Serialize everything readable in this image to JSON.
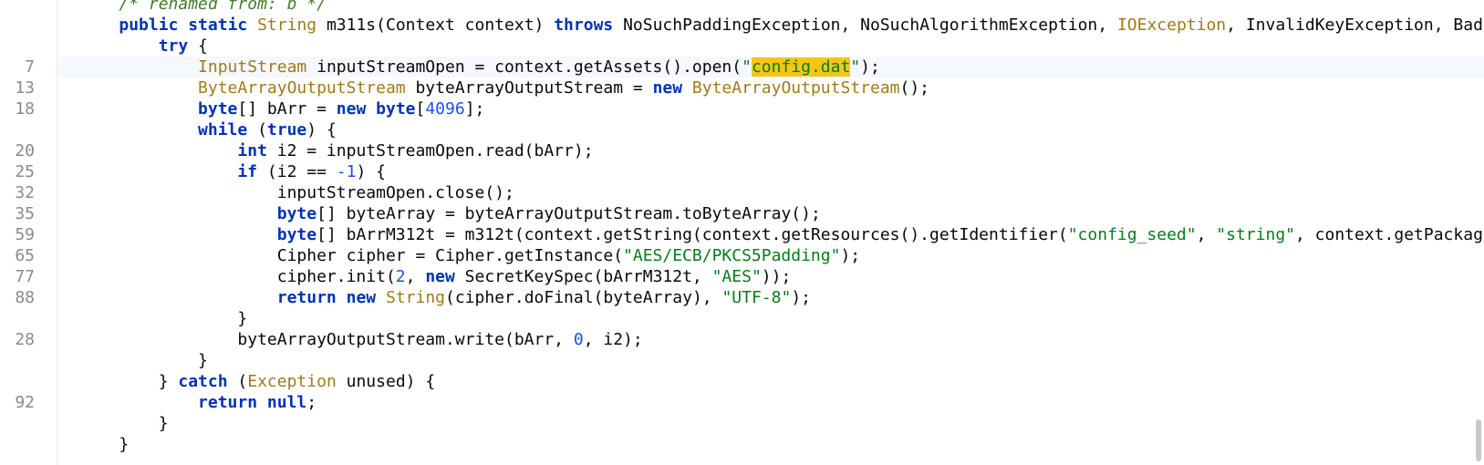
{
  "gutter": {
    "line_numbers": [
      "7",
      "13",
      "18",
      "20",
      "25",
      "32",
      "35",
      "59",
      "65",
      "77",
      "88",
      "28",
      "92"
    ]
  },
  "code": {
    "lines": [
      {
        "ln": "",
        "cls": "",
        "tokens": [
          {
            "t": "    /* renamed from: b */",
            "c": "t-cmt"
          }
        ]
      },
      {
        "ln": "",
        "cls": "",
        "tokens": [
          {
            "t": "    ",
            "c": "t-plain"
          },
          {
            "t": "public static",
            "c": "t-kw"
          },
          {
            "t": " ",
            "c": "t-plain"
          },
          {
            "t": "String",
            "c": "t-cls"
          },
          {
            "t": " m311s(Context context) ",
            "c": "t-plain"
          },
          {
            "t": "throws",
            "c": "t-kw"
          },
          {
            "t": " NoSuchPaddingException, NoSuchAlgorithmException, ",
            "c": "t-plain"
          },
          {
            "t": "IOException",
            "c": "t-cls"
          },
          {
            "t": ", InvalidKeyException, BadPaddingException, IllegalBlockSizeException {",
            "c": "t-plain"
          }
        ]
      },
      {
        "ln": "",
        "cls": "",
        "tokens": [
          {
            "t": "        ",
            "c": "t-plain"
          },
          {
            "t": "try",
            "c": "t-kw"
          },
          {
            "t": " {",
            "c": "t-plain"
          }
        ]
      },
      {
        "ln": "7",
        "cls": "current",
        "tokens": [
          {
            "t": "            ",
            "c": "t-plain"
          },
          {
            "t": "InputStream",
            "c": "t-cls"
          },
          {
            "t": " inputStreamOpen = context.getAssets().open(",
            "c": "t-plain"
          },
          {
            "t": "\"",
            "c": "t-str"
          },
          {
            "t": "config.dat",
            "c": "t-hl"
          },
          {
            "t": "\"",
            "c": "t-str"
          },
          {
            "t": ");",
            "c": "t-plain"
          }
        ]
      },
      {
        "ln": "13",
        "cls": "",
        "tokens": [
          {
            "t": "            ",
            "c": "t-plain"
          },
          {
            "t": "ByteArrayOutputStream",
            "c": "t-cls"
          },
          {
            "t": " byteArrayOutputStream = ",
            "c": "t-plain"
          },
          {
            "t": "new",
            "c": "t-kw"
          },
          {
            "t": " ",
            "c": "t-plain"
          },
          {
            "t": "ByteArrayOutputStream",
            "c": "t-cls"
          },
          {
            "t": "();",
            "c": "t-plain"
          }
        ]
      },
      {
        "ln": "18",
        "cls": "",
        "tokens": [
          {
            "t": "            ",
            "c": "t-plain"
          },
          {
            "t": "byte",
            "c": "t-kw"
          },
          {
            "t": "[] bArr = ",
            "c": "t-plain"
          },
          {
            "t": "new",
            "c": "t-kw"
          },
          {
            "t": " ",
            "c": "t-plain"
          },
          {
            "t": "byte",
            "c": "t-kw"
          },
          {
            "t": "[",
            "c": "t-plain"
          },
          {
            "t": "4096",
            "c": "t-num"
          },
          {
            "t": "];",
            "c": "t-plain"
          }
        ]
      },
      {
        "ln": "",
        "cls": "",
        "tokens": [
          {
            "t": "            ",
            "c": "t-plain"
          },
          {
            "t": "while",
            "c": "t-kw"
          },
          {
            "t": " (",
            "c": "t-plain"
          },
          {
            "t": "true",
            "c": "t-kw"
          },
          {
            "t": ") {",
            "c": "t-plain"
          }
        ]
      },
      {
        "ln": "20",
        "cls": "",
        "tokens": [
          {
            "t": "                ",
            "c": "t-plain"
          },
          {
            "t": "int",
            "c": "t-kw"
          },
          {
            "t": " i2 = inputStreamOpen.read(bArr);",
            "c": "t-plain"
          }
        ]
      },
      {
        "ln": "25",
        "cls": "",
        "tokens": [
          {
            "t": "                ",
            "c": "t-plain"
          },
          {
            "t": "if",
            "c": "t-kw"
          },
          {
            "t": " (i2 == ",
            "c": "t-plain"
          },
          {
            "t": "-1",
            "c": "t-num"
          },
          {
            "t": ") {",
            "c": "t-plain"
          }
        ]
      },
      {
        "ln": "32",
        "cls": "",
        "tokens": [
          {
            "t": "                    inputStreamOpen.close();",
            "c": "t-plain"
          }
        ]
      },
      {
        "ln": "35",
        "cls": "",
        "tokens": [
          {
            "t": "                    ",
            "c": "t-plain"
          },
          {
            "t": "byte",
            "c": "t-kw"
          },
          {
            "t": "[] byteArray = byteArrayOutputStream.toByteArray();",
            "c": "t-plain"
          }
        ]
      },
      {
        "ln": "59",
        "cls": "",
        "tokens": [
          {
            "t": "                    ",
            "c": "t-plain"
          },
          {
            "t": "byte",
            "c": "t-kw"
          },
          {
            "t": "[] bArrM312t = m312t(context.getString(context.getResources().getIdentifier(",
            "c": "t-plain"
          },
          {
            "t": "\"config_seed\"",
            "c": "t-str"
          },
          {
            "t": ", ",
            "c": "t-plain"
          },
          {
            "t": "\"string\"",
            "c": "t-str"
          },
          {
            "t": ", context.getPackageName())));",
            "c": "t-plain"
          }
        ]
      },
      {
        "ln": "65",
        "cls": "",
        "tokens": [
          {
            "t": "                    Cipher cipher = Cipher.getInstance(",
            "c": "t-plain"
          },
          {
            "t": "\"AES/ECB/PKCS5Padding\"",
            "c": "t-str"
          },
          {
            "t": ");",
            "c": "t-plain"
          }
        ]
      },
      {
        "ln": "77",
        "cls": "",
        "tokens": [
          {
            "t": "                    cipher.init(",
            "c": "t-plain"
          },
          {
            "t": "2",
            "c": "t-num"
          },
          {
            "t": ", ",
            "c": "t-plain"
          },
          {
            "t": "new",
            "c": "t-kw"
          },
          {
            "t": " SecretKeySpec(bArrM312t, ",
            "c": "t-plain"
          },
          {
            "t": "\"AES\"",
            "c": "t-str"
          },
          {
            "t": "));",
            "c": "t-plain"
          }
        ]
      },
      {
        "ln": "88",
        "cls": "",
        "tokens": [
          {
            "t": "                    ",
            "c": "t-plain"
          },
          {
            "t": "return",
            "c": "t-kw"
          },
          {
            "t": " ",
            "c": "t-plain"
          },
          {
            "t": "new",
            "c": "t-kw"
          },
          {
            "t": " ",
            "c": "t-plain"
          },
          {
            "t": "String",
            "c": "t-cls"
          },
          {
            "t": "(cipher.doFinal(byteArray), ",
            "c": "t-plain"
          },
          {
            "t": "\"UTF-8\"",
            "c": "t-str"
          },
          {
            "t": ");",
            "c": "t-plain"
          }
        ]
      },
      {
        "ln": "",
        "cls": "",
        "tokens": [
          {
            "t": "                }",
            "c": "t-plain"
          }
        ]
      },
      {
        "ln": "28",
        "cls": "",
        "tokens": [
          {
            "t": "                byteArrayOutputStream.write(bArr, ",
            "c": "t-plain"
          },
          {
            "t": "0",
            "c": "t-num"
          },
          {
            "t": ", i2);",
            "c": "t-plain"
          }
        ]
      },
      {
        "ln": "",
        "cls": "",
        "tokens": [
          {
            "t": "            }",
            "c": "t-plain"
          }
        ]
      },
      {
        "ln": "",
        "cls": "",
        "tokens": [
          {
            "t": "        } ",
            "c": "t-plain"
          },
          {
            "t": "catch",
            "c": "t-kw"
          },
          {
            "t": " (",
            "c": "t-plain"
          },
          {
            "t": "Exception",
            "c": "t-cls"
          },
          {
            "t": " unused) {",
            "c": "t-plain"
          }
        ]
      },
      {
        "ln": "92",
        "cls": "",
        "tokens": [
          {
            "t": "            ",
            "c": "t-plain"
          },
          {
            "t": "return",
            "c": "t-kw"
          },
          {
            "t": " ",
            "c": "t-plain"
          },
          {
            "t": "null",
            "c": "t-kw"
          },
          {
            "t": ";",
            "c": "t-plain"
          }
        ]
      },
      {
        "ln": "",
        "cls": "",
        "tokens": [
          {
            "t": "        }",
            "c": "t-plain"
          }
        ]
      },
      {
        "ln": "",
        "cls": "",
        "tokens": [
          {
            "t": "    }",
            "c": "t-plain"
          }
        ]
      }
    ]
  },
  "colors": {
    "keyword": "#0033b3",
    "string": "#067d17",
    "class": "#a07a1a",
    "number": "#1750eb",
    "highlight": "#f5c518",
    "current_line": "#f5f8fe",
    "line_number": "#8a8a8a"
  }
}
